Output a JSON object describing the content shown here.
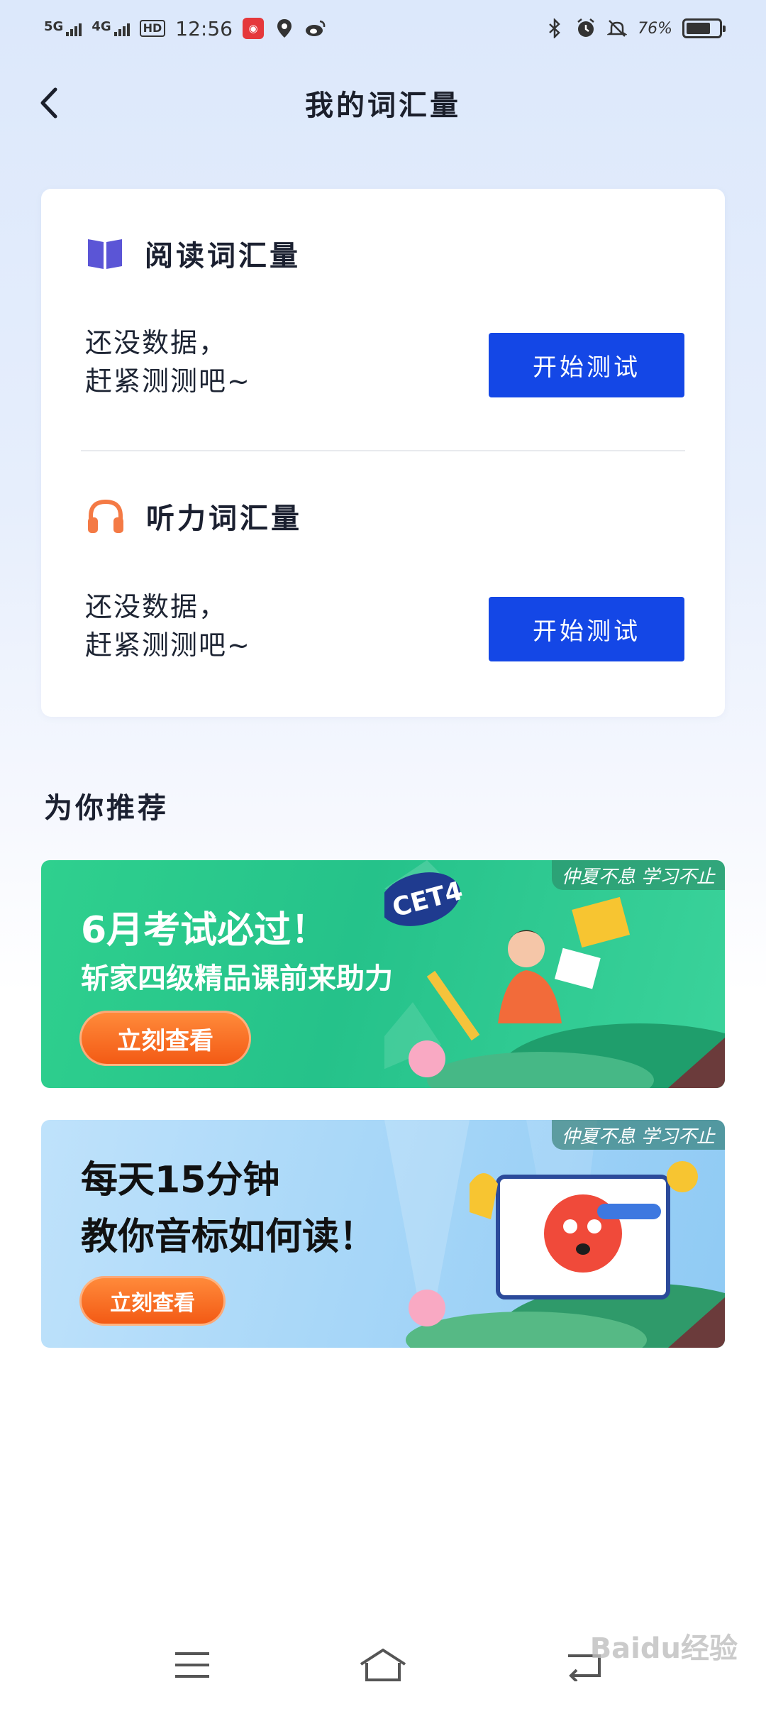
{
  "status_bar": {
    "signal1": "5G",
    "signal2": "4G",
    "hd": "HD",
    "time": "12:56",
    "battery": "76%",
    "battery_level": 0.76
  },
  "header": {
    "title": "我的词汇量"
  },
  "reading": {
    "title": "阅读词汇量",
    "empty_line1": "还没数据，",
    "empty_line2": "赶紧测测吧~",
    "button": "开始测试"
  },
  "listening": {
    "title": "听力词汇量",
    "empty_line1": "还没数据，",
    "empty_line2": "赶紧测测吧~",
    "button": "开始测试"
  },
  "recommend": {
    "title": "为你推荐",
    "banners": [
      {
        "tag": "仲夏不息 学习不止",
        "line1": "6月考试必过！",
        "line2": "斩家四级精品课前来助力",
        "badge": "CET4",
        "button": "立刻查看"
      },
      {
        "tag": "仲夏不息 学习不止",
        "line1": "每天15分钟",
        "line2": "教你音标如何读！",
        "button": "立刻查看"
      }
    ]
  },
  "colors": {
    "primary_button": "#1447e6",
    "banner1_bg": "#2fd08e",
    "banner2_bg": "#a8d7f8",
    "cta_orange": "#f35a15",
    "book_icon": "#5b55d6",
    "headphone_icon": "#f47a45"
  },
  "icons": [
    "back-arrow-icon",
    "book-icon",
    "headphones-icon",
    "menu-icon",
    "home-icon",
    "return-icon"
  ],
  "watermark": "Baidu经验"
}
